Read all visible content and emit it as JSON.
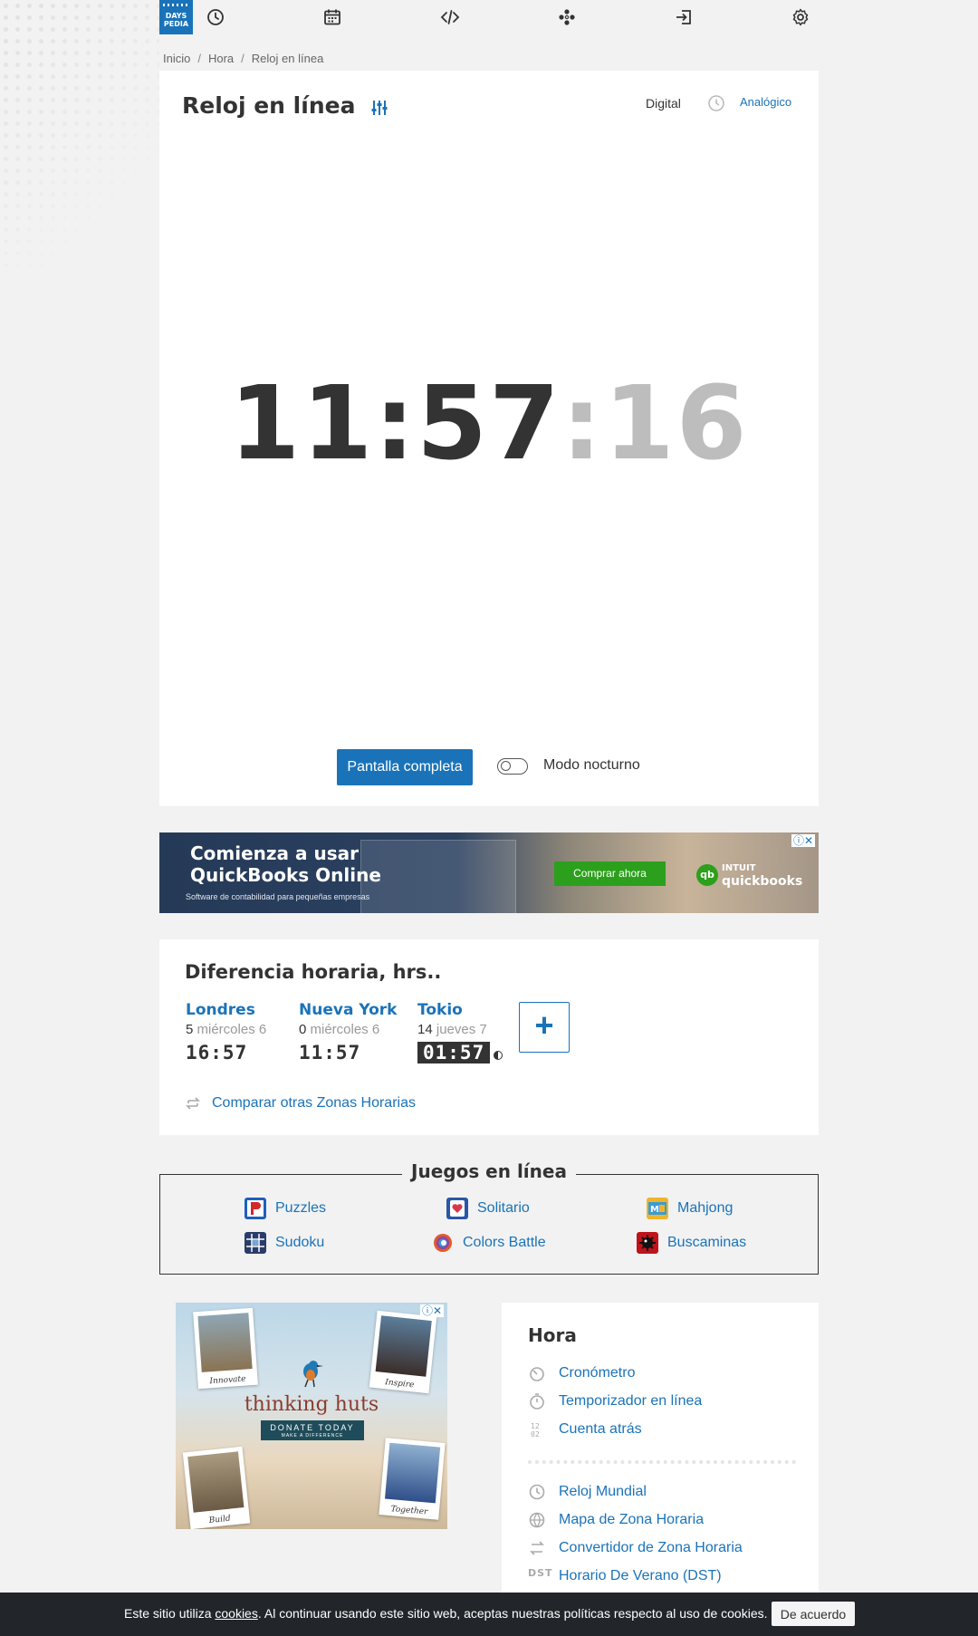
{
  "logo": {
    "line1": "DAYS",
    "line2": "PEDIA"
  },
  "nav": {
    "icons": [
      "clock-icon",
      "calendar-icon",
      "code-icon",
      "games-icon",
      "login-icon",
      "gear-icon"
    ]
  },
  "breadcrumb": [
    "Inicio",
    "Hora",
    "Reloj en línea"
  ],
  "clock": {
    "title": "Reloj en línea",
    "view_digital": "Digital",
    "view_analog": "Analógico",
    "hours_minutes": "11:57",
    "seconds": ":16",
    "fullscreen_label": "Pantalla completa",
    "night_mode_label": "Modo nocturno",
    "night_mode_on": false
  },
  "ad_banner": {
    "headline_1": "Comienza a usar",
    "headline_2": "QuickBooks Online",
    "subtext": "Software de contabilidad para pequeñas empresas",
    "cta": "Comprar ahora",
    "brand_top": "INTUIT",
    "brand_bottom": "quickbooks",
    "brand_badge": "qb"
  },
  "time_difference": {
    "title": "Diferencia horaria, hrs..",
    "cities": [
      {
        "name": "Londres",
        "offset": "5",
        "date": "miércoles 6",
        "time": "16:57",
        "night": false
      },
      {
        "name": "Nueva York",
        "offset": "0",
        "date": "miércoles 6",
        "time": "11:57",
        "night": false
      },
      {
        "name": "Tokio",
        "offset": "14",
        "date": "jueves 7",
        "time": "01:57",
        "night": true
      }
    ],
    "add_label": "+",
    "compare_label": "Comparar otras Zonas Horarias"
  },
  "games": {
    "title": "Juegos en línea",
    "items": [
      {
        "label": "Puzzles",
        "icon": "puzzles-icon",
        "color": "#1f5fbf"
      },
      {
        "label": "Solitario",
        "icon": "solitaire-icon",
        "color": "#d63a4a"
      },
      {
        "label": "Mahjong",
        "icon": "mahjong-icon",
        "color": "#3a9bd6"
      },
      {
        "label": "Sudoku",
        "icon": "sudoku-icon",
        "color": "#2a3d6a"
      },
      {
        "label": "Colors Battle",
        "icon": "colors-battle-icon",
        "color": "#e05a2a"
      },
      {
        "label": "Buscaminas",
        "icon": "minesweeper-icon",
        "color": "#c0121a"
      }
    ]
  },
  "ad_square": {
    "brand": "thinking huts",
    "donate": "DONATE TODAY",
    "donate_sub": "MAKE A DIFFERENCE",
    "captions": [
      "Innovate",
      "Inspire",
      "Build",
      "Together"
    ]
  },
  "side_menu": {
    "title": "Hora",
    "group1": [
      "Cronómetro",
      "Temporizador en línea",
      "Cuenta atrás"
    ],
    "group2": [
      "Reloj Mundial",
      "Mapa de Zona Horaria",
      "Convertidor de Zona Horaria",
      "Horario De Verano (DST)"
    ],
    "dst_badge": "DST"
  },
  "cookie": {
    "before": "Este sitio utiliza ",
    "link": "cookies",
    "after": ". Al continuar usando este sitio web, aceptas nuestras políticas respecto al uso de cookies.",
    "button": "De acuerdo"
  },
  "colors": {
    "accent": "#1a73b9",
    "cookie_bg": "#22262b"
  }
}
